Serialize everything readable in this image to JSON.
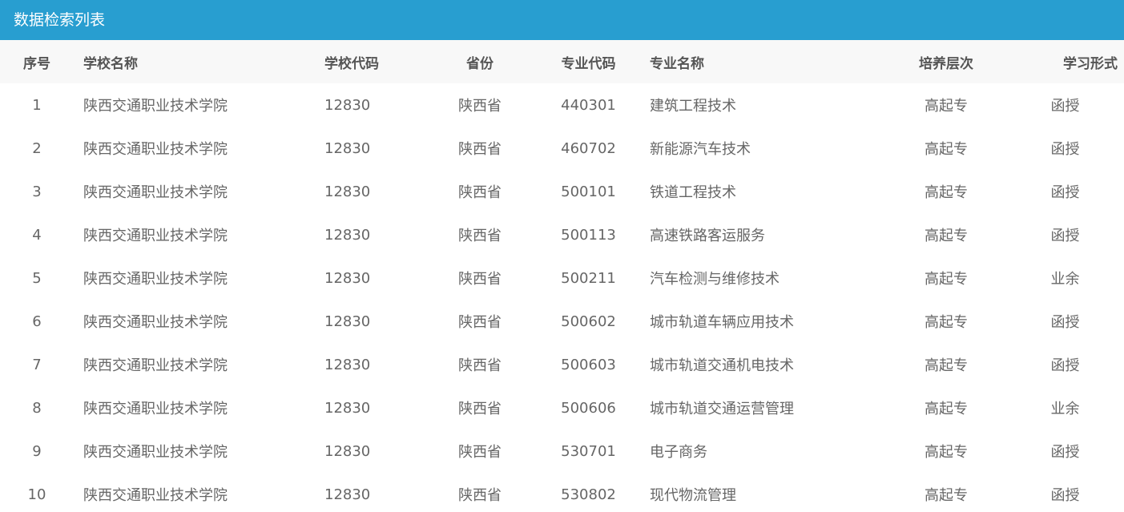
{
  "panel": {
    "title": "数据检索列表"
  },
  "table": {
    "columns": [
      "序号",
      "学校名称",
      "学校代码",
      "省份",
      "专业代码",
      "专业名称",
      "培养层次",
      "学习形式"
    ],
    "rows": [
      [
        "1",
        "陕西交通职业技术学院",
        "12830",
        "陕西省",
        "440301",
        "建筑工程技术",
        "高起专",
        "函授"
      ],
      [
        "2",
        "陕西交通职业技术学院",
        "12830",
        "陕西省",
        "460702",
        "新能源汽车技术",
        "高起专",
        "函授"
      ],
      [
        "3",
        "陕西交通职业技术学院",
        "12830",
        "陕西省",
        "500101",
        "铁道工程技术",
        "高起专",
        "函授"
      ],
      [
        "4",
        "陕西交通职业技术学院",
        "12830",
        "陕西省",
        "500113",
        "高速铁路客运服务",
        "高起专",
        "函授"
      ],
      [
        "5",
        "陕西交通职业技术学院",
        "12830",
        "陕西省",
        "500211",
        "汽车检测与维修技术",
        "高起专",
        "业余"
      ],
      [
        "6",
        "陕西交通职业技术学院",
        "12830",
        "陕西省",
        "500602",
        "城市轨道车辆应用技术",
        "高起专",
        "函授"
      ],
      [
        "7",
        "陕西交通职业技术学院",
        "12830",
        "陕西省",
        "500603",
        "城市轨道交通机电技术",
        "高起专",
        "函授"
      ],
      [
        "8",
        "陕西交通职业技术学院",
        "12830",
        "陕西省",
        "500606",
        "城市轨道交通运营管理",
        "高起专",
        "业余"
      ],
      [
        "9",
        "陕西交通职业技术学院",
        "12830",
        "陕西省",
        "530701",
        "电子商务",
        "高起专",
        "函授"
      ],
      [
        "10",
        "陕西交通职业技术学院",
        "12830",
        "陕西省",
        "530802",
        "现代物流管理",
        "高起专",
        "函授"
      ]
    ]
  }
}
